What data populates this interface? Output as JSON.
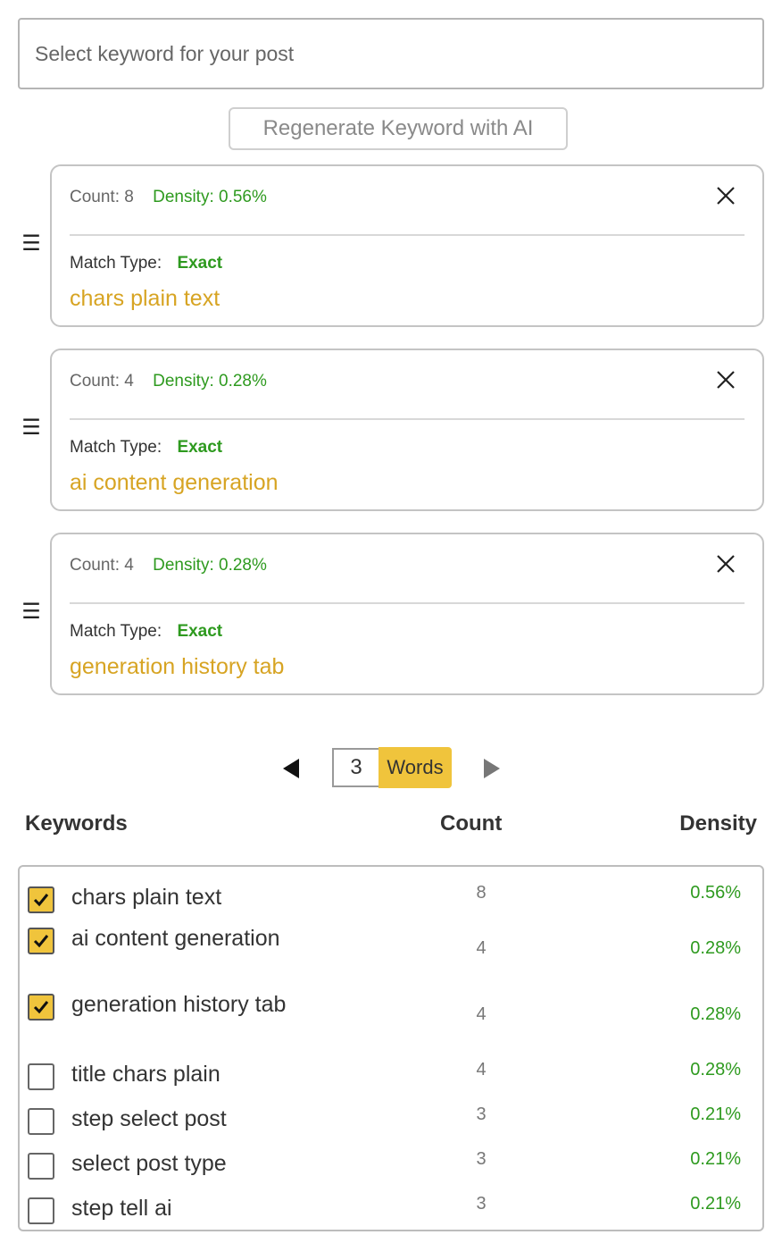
{
  "search": {
    "placeholder": "Select keyword for your post"
  },
  "regenerate_label": "Regenerate Keyword with AI",
  "keyword_cards": [
    {
      "count_text": "Count: 8",
      "density_text": "Density: 0.56%",
      "match_label": "Match Type:",
      "match_value": "Exact",
      "keyword": "chars plain text"
    },
    {
      "count_text": "Count: 4",
      "density_text": "Density: 0.28%",
      "match_label": "Match Type:",
      "match_value": "Exact",
      "keyword": "ai content generation"
    },
    {
      "count_text": "Count: 4",
      "density_text": "Density: 0.28%",
      "match_label": "Match Type:",
      "match_value": "Exact",
      "keyword": "generation history tab"
    }
  ],
  "pager": {
    "value": "3",
    "unit_label": "Words"
  },
  "table": {
    "headers": {
      "keywords": "Keywords",
      "count": "Count",
      "density": "Density"
    },
    "rows": [
      {
        "keyword": "chars plain text",
        "count": "8",
        "density": "0.56%",
        "checked": true
      },
      {
        "keyword": "ai content generation",
        "count": "4",
        "density": "0.28%",
        "checked": true
      },
      {
        "keyword": "generation history tab",
        "count": "4",
        "density": "0.28%",
        "checked": true
      },
      {
        "keyword": "title chars plain",
        "count": "4",
        "density": "0.28%",
        "checked": false
      },
      {
        "keyword": "step select post",
        "count": "3",
        "density": "0.21%",
        "checked": false
      },
      {
        "keyword": "select post type",
        "count": "3",
        "density": "0.21%",
        "checked": false
      },
      {
        "keyword": "step tell ai",
        "count": "3",
        "density": "0.21%",
        "checked": false
      }
    ]
  },
  "icons": {
    "drag": "drag-handle-icon",
    "close": "close-icon",
    "prev": "triangle-left-icon",
    "next": "triangle-right-icon",
    "check": "checkmark-icon"
  },
  "colors": {
    "accent": "#f0c43c",
    "keyword_text": "#d7a423",
    "density_green": "#2e9a1f"
  }
}
